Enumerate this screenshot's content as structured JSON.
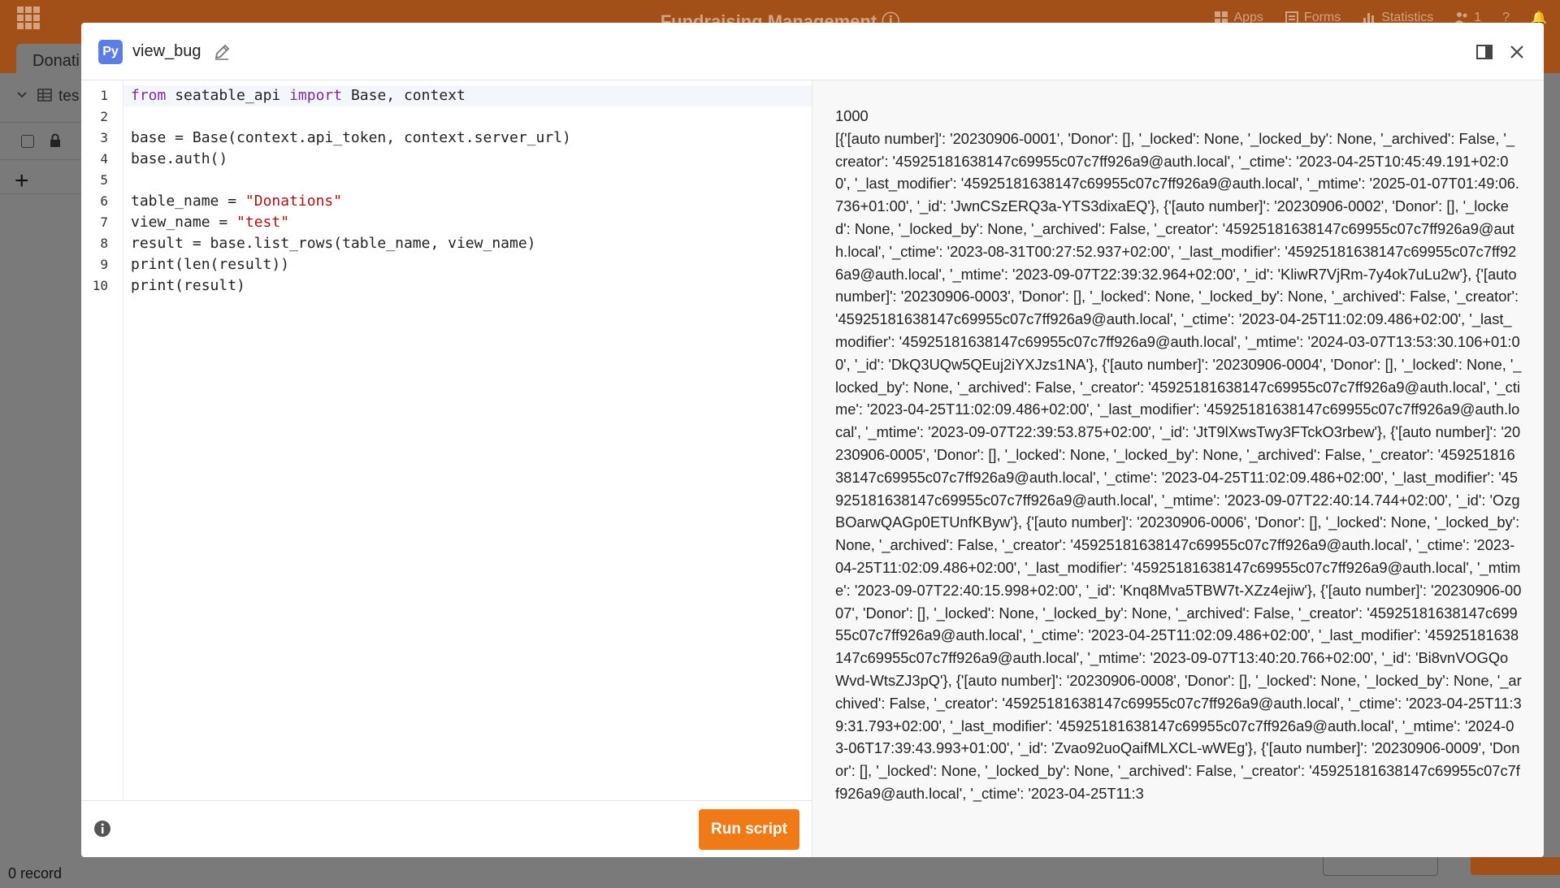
{
  "app": {
    "title": "Fundraising Management",
    "header_items": [
      {
        "label": "Apps",
        "icon": "apps-icon"
      },
      {
        "label": "Forms",
        "icon": "forms-icon"
      },
      {
        "label": "Statistics",
        "icon": "statistics-icon"
      },
      {
        "label": "1",
        "icon": "users-icon"
      }
    ],
    "tab_label": "Donati",
    "view_label": "tes",
    "status_text": "0 record"
  },
  "dialog": {
    "badge": "Py",
    "script_name": "view_bug",
    "run_label": "Run script"
  },
  "code": {
    "lines": [
      "1",
      "2",
      "3",
      "4",
      "5",
      "6",
      "7",
      "8",
      "9",
      "10"
    ],
    "content": {
      "l1_kw1": "from",
      "l1_a": " seatable_api ",
      "l1_kw2": "import",
      "l1_b": " Base, context",
      "l3": "base = Base(context.api_token, context.server_url)",
      "l4": "base.auth()",
      "l6_a": "table_name = ",
      "l6_s": "\"Donations\"",
      "l7_a": "view_name = ",
      "l7_s": "\"test\"",
      "l8": "result = base.list_rows(table_name, view_name)",
      "l9": "print(len(result))",
      "l10": "print(result)"
    }
  },
  "output": {
    "count": "1000",
    "text": "[{'[auto number]': '20230906-0001', 'Donor': [], '_locked': None, '_locked_by': None, '_archived': False, '_creator': '45925181638147c69955c07c7ff926a9@auth.local', '_ctime': '2023-04-25T10:45:49.191+02:00', '_last_modifier': '45925181638147c69955c07c7ff926a9@auth.local', '_mtime': '2025-01-07T01:49:06.736+01:00', '_id': 'JwnCSzERQ3a-YTS3dixaEQ'}, {'[auto number]': '20230906-0002', 'Donor': [], '_locked': None, '_locked_by': None, '_archived': False, '_creator': '45925181638147c69955c07c7ff926a9@auth.local', '_ctime': '2023-08-31T00:27:52.937+02:00', '_last_modifier': '45925181638147c69955c07c7ff926a9@auth.local', '_mtime': '2023-09-07T22:39:32.964+02:00', '_id': 'KliwR7VjRm-7y4ok7uLu2w'}, {'[auto number]': '20230906-0003', 'Donor': [], '_locked': None, '_locked_by': None, '_archived': False, '_creator': '45925181638147c69955c07c7ff926a9@auth.local', '_ctime': '2023-04-25T11:02:09.486+02:00', '_last_modifier': '45925181638147c69955c07c7ff926a9@auth.local', '_mtime': '2024-03-07T13:53:30.106+01:00', '_id': 'DkQ3UQw5QEuj2iYXJzs1NA'}, {'[auto number]': '20230906-0004', 'Donor': [], '_locked': None, '_locked_by': None, '_archived': False, '_creator': '45925181638147c69955c07c7ff926a9@auth.local', '_ctime': '2023-04-25T11:02:09.486+02:00', '_last_modifier': '45925181638147c69955c07c7ff926a9@auth.local', '_mtime': '2023-09-07T22:39:53.875+02:00', '_id': 'JtT9lXwsTwy3FTckO3rbew'}, {'[auto number]': '20230906-0005', 'Donor': [], '_locked': None, '_locked_by': None, '_archived': False, '_creator': '45925181638147c69955c07c7ff926a9@auth.local', '_ctime': '2023-04-25T11:02:09.486+02:00', '_last_modifier': '45925181638147c69955c07c7ff926a9@auth.local', '_mtime': '2023-09-07T22:40:14.744+02:00', '_id': 'OzgBOarwQAGp0ETUnfKByw'}, {'[auto number]': '20230906-0006', 'Donor': [], '_locked': None, '_locked_by': None, '_archived': False, '_creator': '45925181638147c69955c07c7ff926a9@auth.local', '_ctime': '2023-04-25T11:02:09.486+02:00', '_last_modifier': '45925181638147c69955c07c7ff926a9@auth.local', '_mtime': '2023-09-07T22:40:15.998+02:00', '_id': 'Knq8Mva5TBW7t-XZz4ejiw'}, {'[auto number]': '20230906-0007', 'Donor': [], '_locked': None, '_locked_by': None, '_archived': False, '_creator': '45925181638147c69955c07c7ff926a9@auth.local', '_ctime': '2023-04-25T11:02:09.486+02:00', '_last_modifier': '45925181638147c69955c07c7ff926a9@auth.local', '_mtime': '2023-09-07T13:40:20.766+02:00', '_id': 'Bi8vnVOGQoWvd-WtsZJ3pQ'}, {'[auto number]': '20230906-0008', 'Donor': [], '_locked': None, '_locked_by': None, '_archived': False, '_creator': '45925181638147c69955c07c7ff926a9@auth.local', '_ctime': '2023-04-25T11:39:31.793+02:00', '_last_modifier': '45925181638147c69955c07c7ff926a9@auth.local', '_mtime': '2024-03-06T17:39:43.993+01:00', '_id': 'Zvao92uoQaifMLXCL-wWEg'}, {'[auto number]': '20230906-0009', 'Donor': [], '_locked': None, '_locked_by': None, '_archived': False, '_creator': '45925181638147c69955c07c7ff926a9@auth.local', '_ctime': '2023-04-25T11:3"
  },
  "colors": {
    "brand": "#a34f18",
    "run_button": "#ef7a16",
    "py_badge": "#5a7de6",
    "keyword": "#7a2d9e",
    "string": "#a31515"
  }
}
